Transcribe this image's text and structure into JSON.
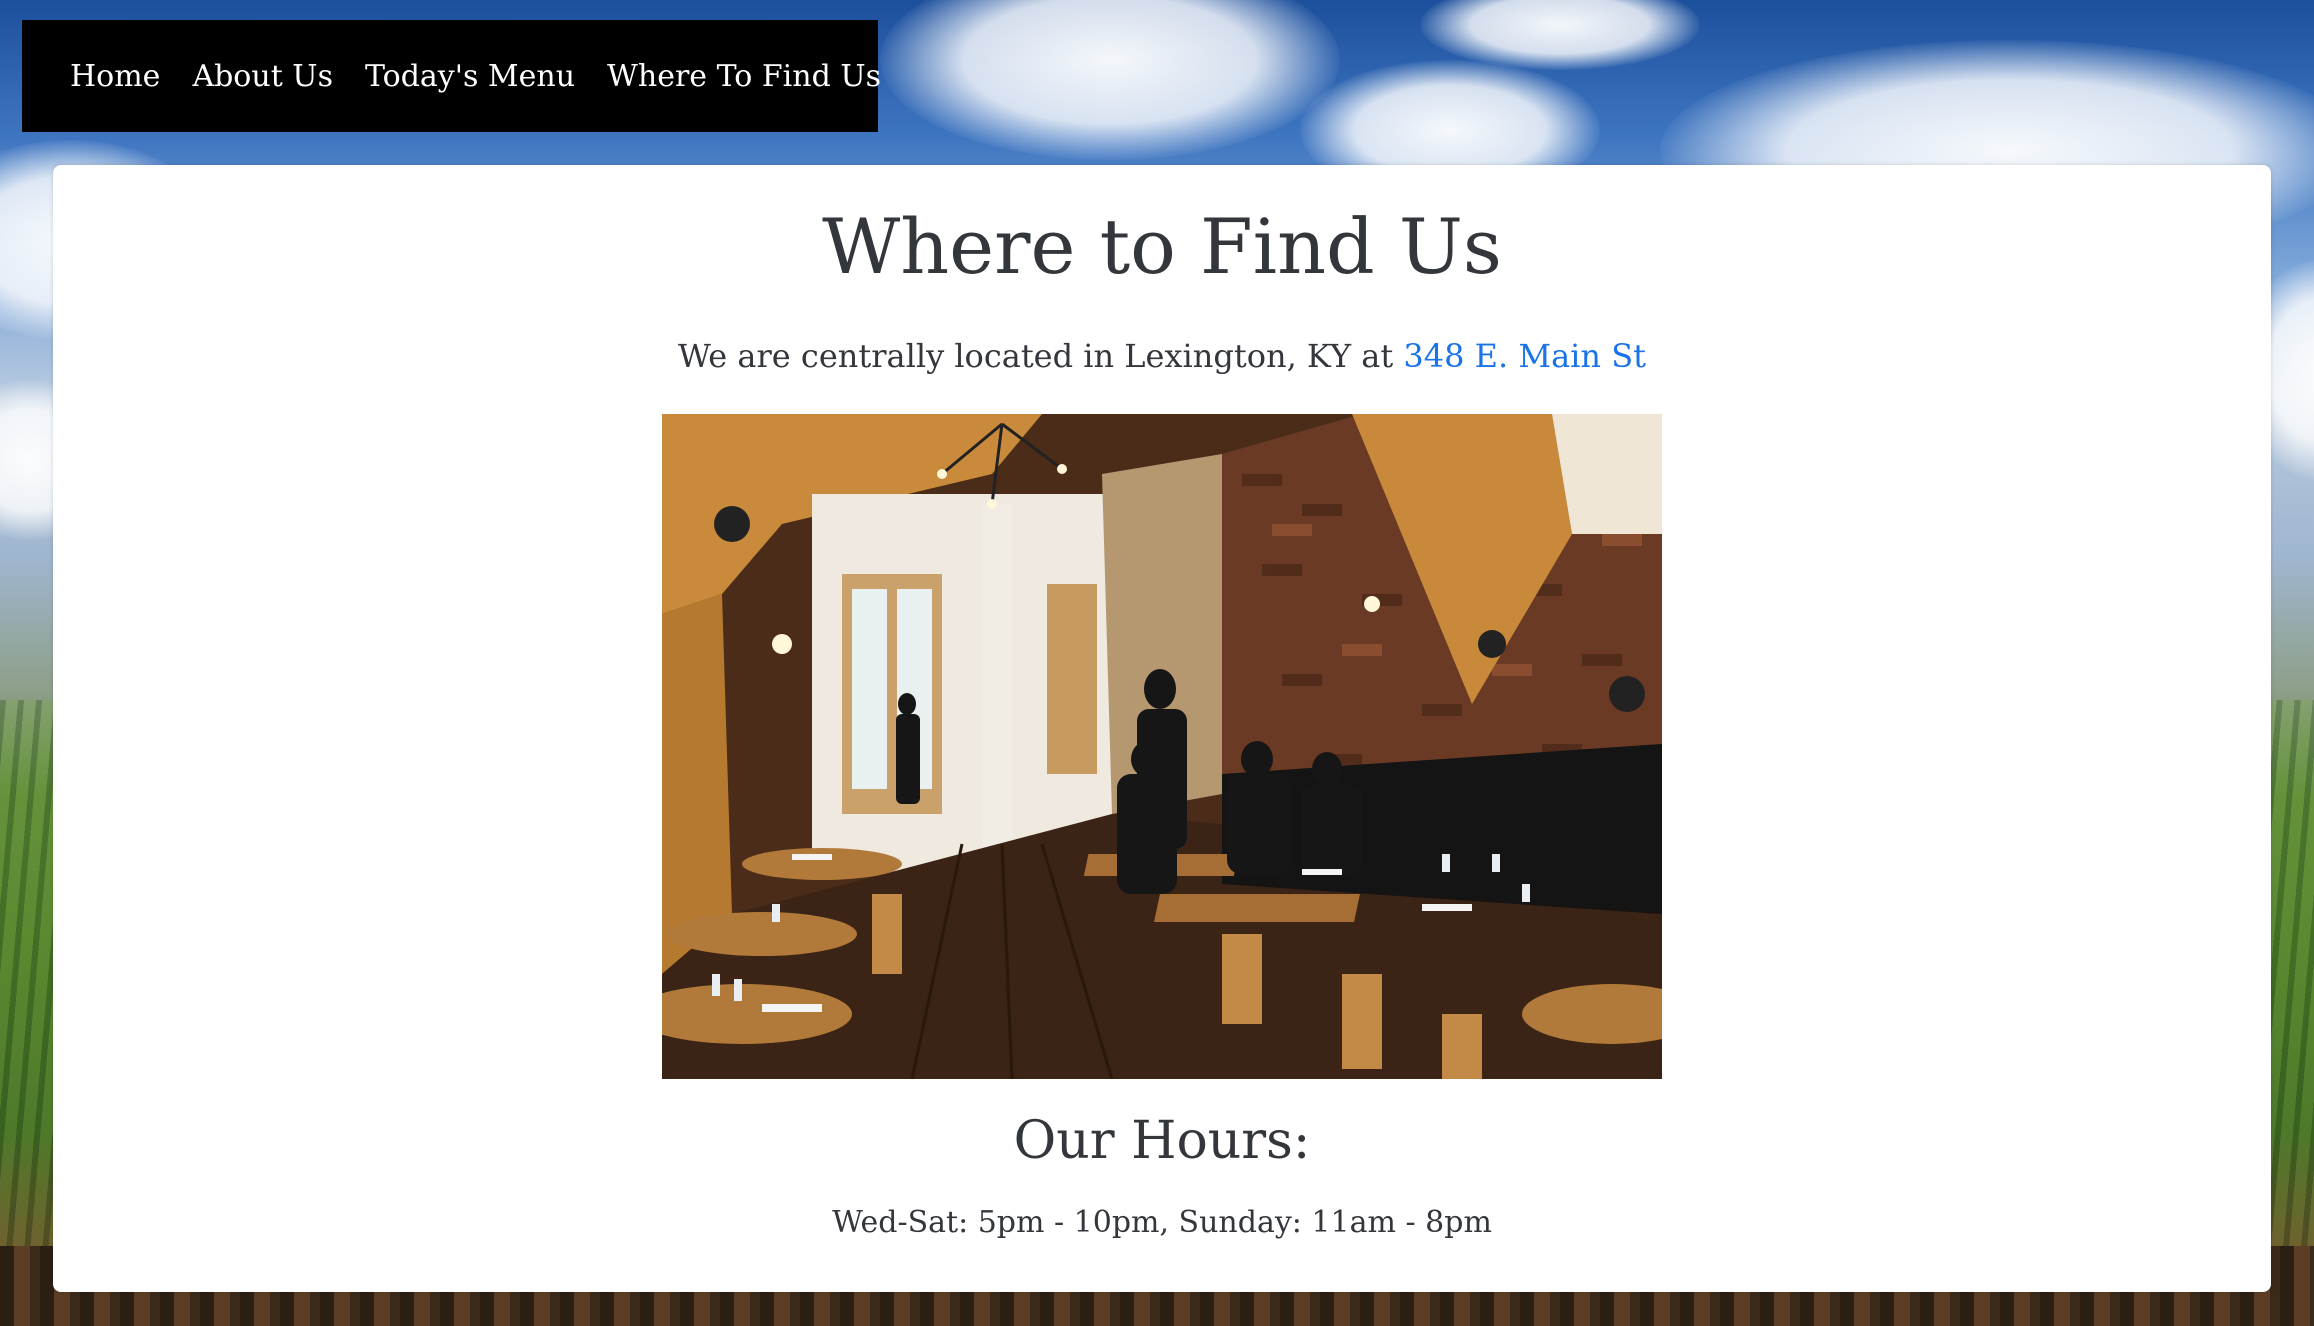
{
  "nav": {
    "items": [
      {
        "label": "Home"
      },
      {
        "label": "About Us"
      },
      {
        "label": "Today's Menu"
      },
      {
        "label": "Where To Find Us"
      }
    ]
  },
  "main": {
    "title": "Where to Find Us",
    "intro_text": "We are centrally located in Lexington, KY at ",
    "address_link": "348 E. Main St",
    "photo_icon": "restaurant-interior-photo",
    "hours_title": "Our Hours:",
    "hours_text": "Wed-Sat: 5pm - 10pm, Sunday: 11am - 8pm"
  },
  "colors": {
    "nav_background": "#000000",
    "nav_text": "#ffffff",
    "link": "#1a73e8",
    "text": "#33363b",
    "card_background": "#ffffff"
  }
}
